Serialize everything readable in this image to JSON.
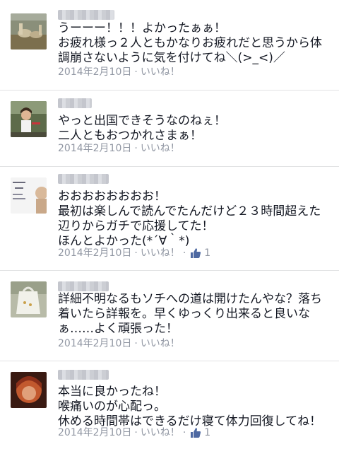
{
  "comments": [
    {
      "text": "うーーー！！！よかったぁぁ！\nお疲れ様っ２人ともかなりお疲れだと思うから体調崩さないように気を付けてね＼(>_<)／",
      "date": "2014年2月10日",
      "like_link": "いいね！"
    },
    {
      "text": "やっと出国できそうなのねぇ！\n二人ともおつかれさまぁ！",
      "date": "2014年2月10日",
      "like_link": "いいね！"
    },
    {
      "text": "おおおおおおおお！\n最初は楽しんで読んでたんだけど２３時間超えた辺りからガチで応援してた！\nほんとよかった(*´∀｀*)",
      "date": "2014年2月10日",
      "like_link": "いいね！",
      "like_count": "1"
    },
    {
      "text": "詳細不明なるもソチへの道は開けたんやな？落ち着いたら詳報を。早くゆっくり出来ると良いなぁ……よく頑張った！",
      "date": "2014年2月10日",
      "like_link": "いいね！"
    },
    {
      "text": "本当に良かったね！\n喉痛いのが心配っ。\n休める時間帯はできるだけ寝て体力回復してね！",
      "date": "2014年2月10日",
      "like_link": "いいね！",
      "like_count": "1"
    }
  ],
  "icons": {
    "like": "thumbs-up-icon"
  },
  "colors": {
    "meta": "#9197a3",
    "like_blue": "#4e69a2",
    "divider": "#e1e2e3"
  }
}
